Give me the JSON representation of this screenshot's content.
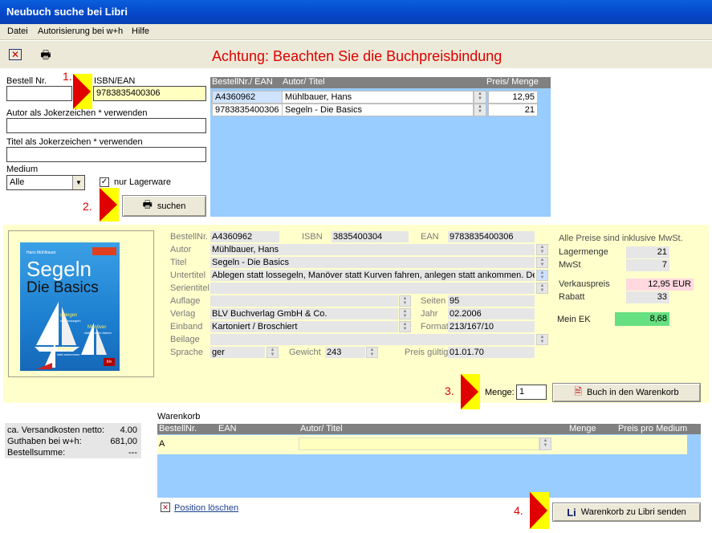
{
  "window": {
    "title": "Neubuch suche bei Libri"
  },
  "menu": {
    "items": [
      "Datei",
      "Autorisierung bei w+h",
      "Hilfe"
    ]
  },
  "warning": "Achtung: Beachten Sie die Buchpreisbindung",
  "steps": [
    "1.",
    "2.",
    "3.",
    "4."
  ],
  "search": {
    "bestell_label": "Bestell Nr.",
    "bestell_value": "",
    "isbn_label": "ISBN/EAN",
    "isbn_value": "9783835400306",
    "autor_label": "Autor als Jokerzeichen * verwenden",
    "autor_value": "",
    "titel_label": "Titel als Jokerzeichen * verwenden",
    "titel_value": "",
    "medium_label": "Medium",
    "medium_value": "Alle",
    "lager_label": "nur Lagerware",
    "lager_checked": true,
    "search_button": "suchen"
  },
  "results": {
    "headers": [
      "BestellNr./ EAN",
      "Autor/ Titel",
      "Preis/ Menge"
    ],
    "rows": [
      {
        "id": "A4360962",
        "text": "Mühlbauer, Hans",
        "value": "12,95"
      },
      {
        "id": "9783835400306",
        "text": "Segeln - Die Basics",
        "value": "21"
      }
    ]
  },
  "cover": {
    "author": "Hans Mühlbauer",
    "title1": "Segeln",
    "title2": "Die Basics",
    "line1": "ablegen",
    "line2": "statt lossegeln",
    "line3": "Manöver",
    "line4": "statt Kurven fahren",
    "line5": "anlegen",
    "line6": "statt ankommen",
    "publisher": "blv"
  },
  "detail": {
    "bestellnr_label": "BestellNr.",
    "bestellnr": "A4360962",
    "isbn_label": "ISBN",
    "isbn": "3835400304",
    "ean_label": "EAN",
    "ean": "9783835400306",
    "autor_label": "Autor",
    "autor": "Mühlbauer, Hans",
    "titel_label": "Titel",
    "titel": "Segeln - Die Basics",
    "untertitel_label": "Untertitel",
    "untertitel": "Ablegen statt lossegeln, Manöver statt Kurven fahren, anlegen statt ankommen. Der",
    "serientitel_label": "Serientitel",
    "serientitel": "",
    "auflage_label": "Auflage",
    "auflage": "",
    "seiten_label": "Seiten",
    "seiten": "95",
    "verlag_label": "Verlag",
    "verlag": "BLV Buchverlag GmbH & Co.",
    "jahr_label": "Jahr",
    "jahr": "02.2006",
    "einband_label": "Einband",
    "einband": "Kartoniert / Broschiert",
    "format_label": "Format",
    "format": "213/167/10",
    "beilage_label": "Beilage",
    "beilage": "",
    "sprache_label": "Sprache",
    "sprache": "ger",
    "gewicht_label": "Gewicht",
    "gewicht": "243",
    "preis_label": "Preis gültig",
    "preis": "01.01.70"
  },
  "prices": {
    "note": "Alle Preise sind inklusive MwSt.",
    "lager_label": "Lagermenge",
    "lager": "21",
    "mwst_label": "MwSt",
    "mwst": "7",
    "vk_label": "Verkauspreis",
    "vk": "12,95 EUR",
    "rabatt_label": "Rabatt",
    "rabatt": "33",
    "ek_label": "Mein EK",
    "ek": "8,68"
  },
  "order": {
    "menge_label": "Menge:",
    "menge": "1",
    "add_button": "Buch in den Warenkorb"
  },
  "info": {
    "versand_label": "ca. Versandkosten netto:",
    "versand": "4.00",
    "guthaben_label": "Guthaben bei w+h:",
    "guthaben": "681,00",
    "summe_label": "Bestellsumme:",
    "summe": "---"
  },
  "cart": {
    "title": "Warenkorb",
    "headers": [
      "BestellNr.",
      "EAN",
      "Autor/ Titel",
      "Menge",
      "Preis pro Medium"
    ],
    "row_id": "A",
    "delete_label": "Position löschen",
    "send_button": "Warenkorb zu Libri senden",
    "send_icon": "Li"
  },
  "colors": {
    "accent_red": "#e00000",
    "flag_yellow": "#ffff00",
    "list_blue": "#99ccff",
    "detail_yellow": "#ffffcc",
    "ek_green": "#66e080"
  }
}
